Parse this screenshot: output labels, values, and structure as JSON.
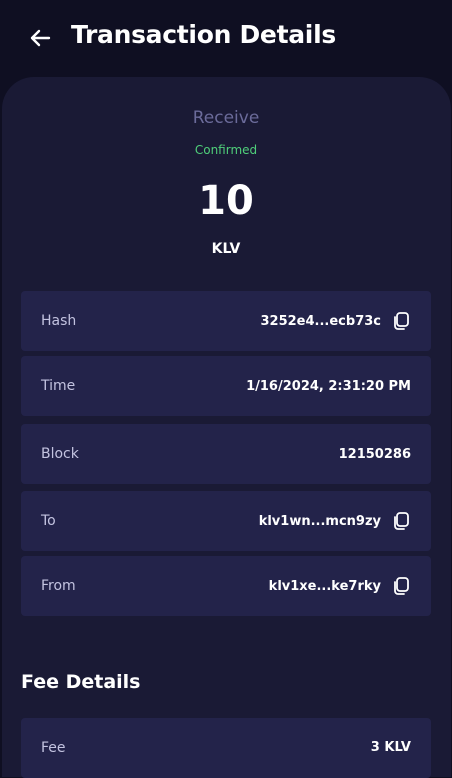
{
  "header": {
    "title": "Transaction Details",
    "back_icon": "arrow-left-icon"
  },
  "summary": {
    "type": "Receive",
    "status": "Confirmed",
    "status_color": "#4fcf7a",
    "amount": "10",
    "asset": "KLV"
  },
  "details": [
    {
      "label": "Hash",
      "value": "3252e4...ecb73c",
      "copy": true
    },
    {
      "label": "Time",
      "value": "1/16/2024, 2:31:20 PM",
      "copy": false
    },
    {
      "label": "Block",
      "value": "12150286",
      "copy": false
    },
    {
      "label": "To",
      "value": "klv1wn...mcn9zy",
      "copy": true
    },
    {
      "label": "From",
      "value": "klv1xe...ke7rky",
      "copy": true
    }
  ],
  "fees": {
    "title": "Fee Details",
    "items": [
      {
        "label": "Fee",
        "value": "3 KLV"
      }
    ]
  },
  "colors": {
    "background": "#0f0f22",
    "panel": "#1a1a35",
    "row": "#23234a"
  }
}
